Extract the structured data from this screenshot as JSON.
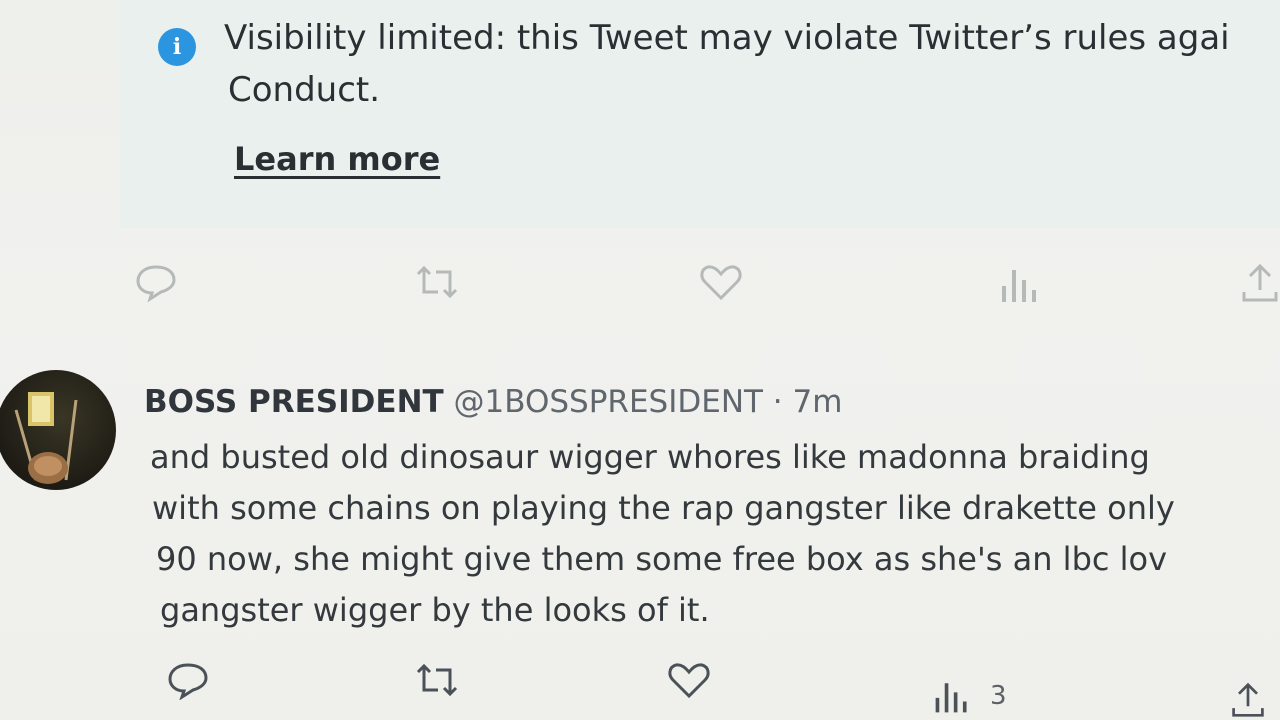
{
  "notice": {
    "icon": "info-icon",
    "line1": "Visibility limited: this Tweet may violate Twitter’s rules agai",
    "line2": "Conduct.",
    "learn_more": "Learn more"
  },
  "tweet": {
    "display_name": "BOSS PRESIDENT",
    "handle_time": "@1BOSSPRESIDENT · 7m",
    "lines": [
      "and busted old dinosaur wigger whores like madonna braiding",
      "with some chains on playing the rap gangster like drakette only",
      "90 now, she might give them some free box as she's an lbc lov",
      "gangster wigger by the looks of it."
    ],
    "views_count": "3"
  },
  "icons": {
    "reply": "reply-icon",
    "retweet": "retweet-icon",
    "like": "heart-icon",
    "views": "views-icon",
    "share": "share-icon"
  },
  "colors": {
    "info_blue": "#2b95e0",
    "muted_icon": "#b5bab8",
    "active_icon": "#4a5157"
  }
}
